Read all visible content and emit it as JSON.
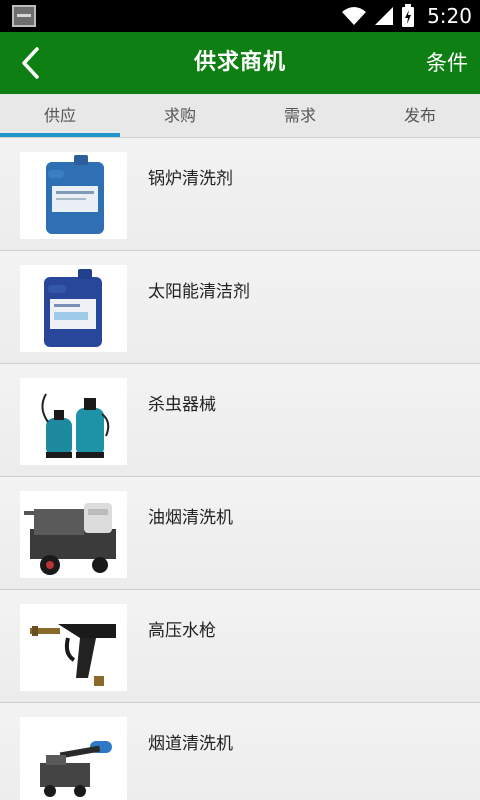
{
  "status_bar": {
    "time": "5:20"
  },
  "app_bar": {
    "back_icon": "chevron-left-icon",
    "title": "供求商机",
    "filter_label": "条件"
  },
  "tabs": [
    {
      "label": "供应",
      "active": true
    },
    {
      "label": "求购",
      "active": false
    },
    {
      "label": "需求",
      "active": false
    },
    {
      "label": "发布",
      "active": false
    }
  ],
  "items": [
    {
      "title": "锅炉清洗剂",
      "image": "blue-chemical-drum"
    },
    {
      "title": "太阳能清洁剂",
      "image": "blue-chemical-drum"
    },
    {
      "title": "杀虫器械",
      "image": "sprayers"
    },
    {
      "title": "油烟清洗机",
      "image": "pressure-washer-machine"
    },
    {
      "title": "高压水枪",
      "image": "spray-gun"
    },
    {
      "title": "烟道清洗机",
      "image": "duct-cleaning-machine"
    }
  ],
  "colors": {
    "app_bar": "#0e7f12",
    "tab_indicator": "#2196c9",
    "tab_bar": "#e8e8e8"
  }
}
